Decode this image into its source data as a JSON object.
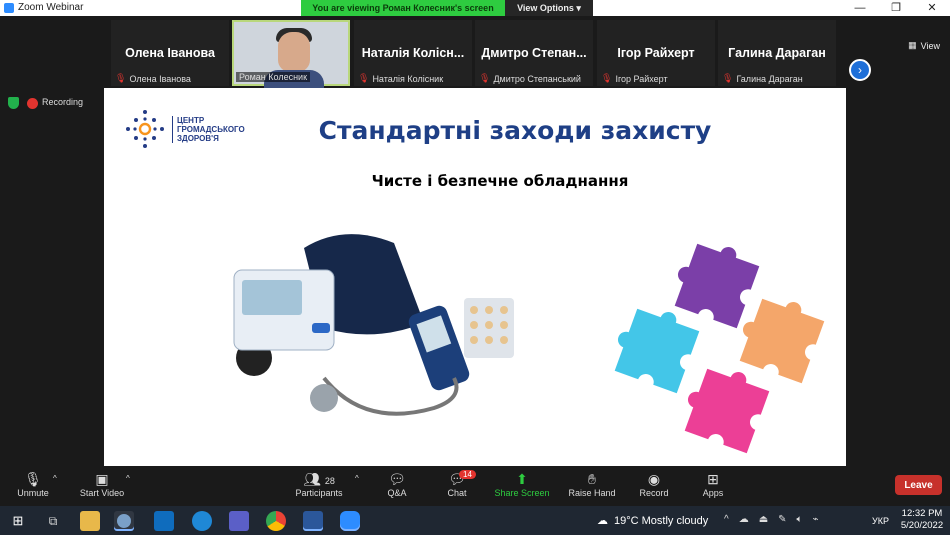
{
  "titlebar": {
    "app_title": "Zoom Webinar",
    "controls": [
      "—",
      "❐",
      "✕"
    ]
  },
  "banner": {
    "message": "You are viewing Роман Колесник's screen",
    "options_label": "View Options ▾"
  },
  "view_button": {
    "label": "View"
  },
  "participants": [
    {
      "name": "Олена Іванова",
      "sub": "Олена Іванова"
    },
    {
      "name": "",
      "sub": "Роман Колесник"
    },
    {
      "name": "Наталія Колісн...",
      "sub": "Наталія Колісник"
    },
    {
      "name": "Дмитро  Степан...",
      "sub": "Дмитро Степанський"
    },
    {
      "name": "Ігор Райхерт",
      "sub": "Ігор Райхерт"
    },
    {
      "name": "Галина Дараган",
      "sub": "Галина Дараган"
    }
  ],
  "recording": {
    "label": "Recording"
  },
  "slide": {
    "logo_lines": [
      "ЦЕНТР",
      "ГРОМАДСЬКОГО",
      "ЗДОРОВ'Я"
    ],
    "title": "Стандартні заходи захисту",
    "subtitle": "Чисте і безпечне обладнання",
    "puzzle_colors": [
      "#7b3fa8",
      "#f4a66a",
      "#43c6e8",
      "#ec3f96"
    ]
  },
  "toolbar": {
    "unmute": "Unmute",
    "start_video": "Start Video",
    "participants": "Participants",
    "participants_count": "28",
    "qa": "Q&A",
    "chat": "Chat",
    "chat_badge": "14",
    "share": "Share Screen",
    "raise": "Raise Hand",
    "record": "Record",
    "apps": "Apps",
    "leave": "Leave"
  },
  "taskbar": {
    "weather": "19°C  Mostly cloudy",
    "lang": "УКР",
    "time": "12:32 PM",
    "date": "5/20/2022"
  }
}
